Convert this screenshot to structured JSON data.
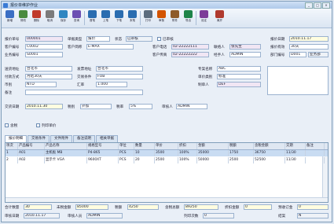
{
  "window": {
    "title": "报价单维护作业",
    "min": "_",
    "max": "□",
    "close": "×"
  },
  "toolbar": {
    "buttons": [
      "新增",
      "修改",
      "删除",
      "取消",
      "保存",
      "查询",
      "首笔",
      "上笔",
      "下笔",
      "末笔",
      "打印",
      "审核",
      "附件",
      "导出",
      "设定",
      "离开"
    ],
    "colors": [
      "#3b6fc4",
      "#4a8a3f",
      "#c0392b",
      "#7b7b7b",
      "#2e86c1",
      "#6c4fb3",
      "#2a6db0",
      "#2a6db0",
      "#2a6db0",
      "#2a6db0",
      "#5d6d7e",
      "#d35400",
      "#8e5b2a",
      "#1e8449",
      "#7d3c98",
      "#b03a2e"
    ]
  },
  "form": {
    "quote_no_label": "报价单号",
    "quote_no": "000001",
    "doc_type_label": "单据类型",
    "doc_type": "报价",
    "status_label": "状态",
    "status": "已审核",
    "audit_label": "已审核",
    "quote_date_label": "报价日期",
    "quote_date": "2010.11.17",
    "cust_no_label": "客户编号",
    "cust_no": "C0002",
    "cust_short_label": "客户简称",
    "cust_short": "E-MAX",
    "phone_label": "客户电话",
    "phone": "02-22222111",
    "contact_label": "联络人",
    "contact": "张先生",
    "valid_label": "报价有效",
    "valid": "30天",
    "sales_no_label": "业务编号",
    "sales_no": "S0001",
    "fax_label": "客户传真",
    "fax": "02-22222222",
    "person_label": "经手人",
    "person": "ADMIN",
    "dept_label": "部门编号",
    "dept": "D001",
    "dept_name": "业务部",
    "ship_addr_label": "送货地址",
    "ship_addr": "台北市",
    "inv_addr_label": "发票地址",
    "inv_addr": "台北市",
    "pay_label": "付款方式",
    "pay": "月结30天",
    "cond_label": "交易条件",
    "cond": "FOB",
    "cur_label": "币别",
    "cur": "NTD",
    "rate_label": "汇率",
    "rate": "1.000",
    "remark_label": "备注",
    "remark": "",
    "deliver_label": "交货日期",
    "deliver": "2010.11.30",
    "tax_label": "税别",
    "tax": "外加",
    "tax_rate_label": "税率",
    "tax_rate": "5%",
    "proj_label": "专案名称",
    "proj": "ABC",
    "maker_label": "制单人",
    "maker": "DEF",
    "price_kind_label": "单价类别",
    "price_kind": "标准",
    "check1": "含税",
    "check2": "列印单价",
    "audit_person_label": "审核人",
    "audit_person": "ADMIN"
  },
  "tabs": [
    "报价明细",
    "交易条件",
    "文件附件",
    "备注说明",
    "相关单据"
  ],
  "grid": {
    "headers": [
      "项次",
      "产品编号",
      "产品名称",
      "规格型号",
      "单位",
      "数量",
      "单价",
      "折扣",
      "金额",
      "税额",
      "含税金额",
      "交期",
      "备注"
    ],
    "rows": [
      [
        "1",
        "A01",
        "主机板 MB",
        "P4-865",
        "PCS",
        "10",
        "3500",
        "100%",
        "35000",
        "1750",
        "36750",
        "11/30",
        ""
      ],
      [
        "2",
        "A02",
        "显示卡 VGA",
        "9600XT",
        "PCS",
        "20",
        "2500",
        "100%",
        "50000",
        "2500",
        "52500",
        "11/30",
        ""
      ]
    ]
  },
  "footer": {
    "qty_label": "合计数量",
    "qty": "30",
    "amt_label": "未税金额",
    "amt": "85000",
    "tax_label": "税额",
    "tax": "4250",
    "total_label": "含税总额",
    "total": "89250",
    "disc_label": "折扣金额",
    "disc": "0",
    "dep_label": "预收订金",
    "dep": "0",
    "audit_date_label": "审核日期",
    "audit_date": "2010.11.17",
    "audit_by_label": "审核人员",
    "audit_by": "ADMIN",
    "print_count_label": "列印次数",
    "print_count": "0",
    "close_label": "结案",
    "close": "N"
  }
}
